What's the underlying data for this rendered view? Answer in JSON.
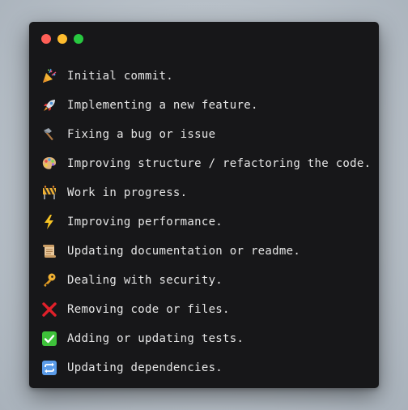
{
  "window": {
    "buttons": {
      "close_color": "#ff5f57",
      "minimize_color": "#febc2e",
      "maximize_color": "#28c840"
    }
  },
  "entries": [
    {
      "icon": "party-popper-icon",
      "text": "Initial commit."
    },
    {
      "icon": "rocket-icon",
      "text": "Implementing a new feature."
    },
    {
      "icon": "hammer-icon",
      "text": "Fixing a bug or issue"
    },
    {
      "icon": "artist-palette-icon",
      "text": "Improving structure / refactoring the code."
    },
    {
      "icon": "construction-icon",
      "text": "Work in progress."
    },
    {
      "icon": "lightning-icon",
      "text": "Improving performance."
    },
    {
      "icon": "scroll-icon",
      "text": "Updating documentation or readme."
    },
    {
      "icon": "key-icon",
      "text": "Dealing with security."
    },
    {
      "icon": "cross-mark-icon",
      "text": "Removing code or files."
    },
    {
      "icon": "check-mark-icon",
      "text": "Adding or updating tests."
    },
    {
      "icon": "repeat-icon",
      "text": "Updating dependencies."
    }
  ]
}
